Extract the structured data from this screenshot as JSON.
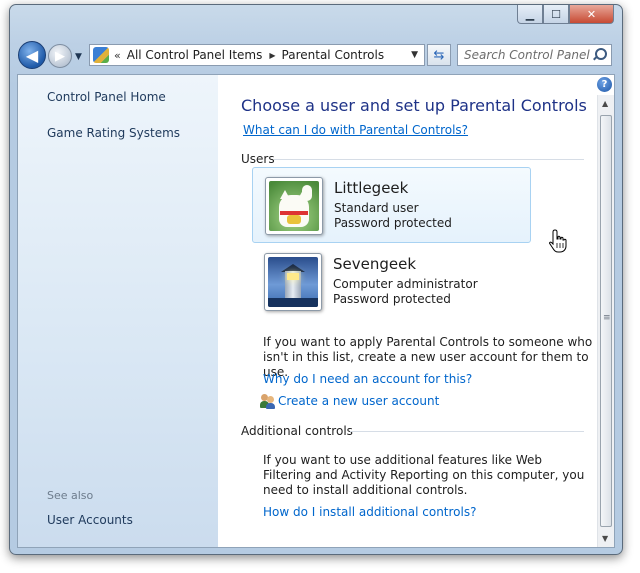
{
  "window": {
    "caption": {
      "minimize": "▁",
      "maximize": "☐",
      "close": "✕"
    }
  },
  "nav": {
    "back_icon": "arrow-left-icon",
    "forward_icon": "arrow-right-icon",
    "address": {
      "chevron": "«",
      "crumbs": [
        "All Control Panel Items",
        "Parental Controls"
      ],
      "separator": "▶"
    },
    "search": {
      "placeholder": "Search Control Panel"
    }
  },
  "sidebar": {
    "items": [
      {
        "label": "Control Panel Home"
      },
      {
        "label": "Game Rating Systems"
      }
    ],
    "see_also": {
      "heading": "See also",
      "items": [
        {
          "label": "User Accounts"
        }
      ]
    }
  },
  "main": {
    "title": "Choose a user and set up Parental Controls",
    "help_link": "What can I do with Parental Controls?",
    "users_heading": "Users",
    "users": [
      {
        "name": "Littlegeek",
        "type": "Standard user",
        "status": "Password protected",
        "selected": true,
        "picture": "lucky-cat-icon"
      },
      {
        "name": "Sevengeek",
        "type": "Computer administrator",
        "status": "Password protected",
        "selected": false,
        "picture": "lighthouse-icon"
      }
    ],
    "apply_text": "If you want to apply Parental Controls to someone who isn't in this list, create a new user account for them to use.",
    "why_link": "Why do I need an account for this?",
    "create_link": "Create a new user account",
    "additional_heading": "Additional controls",
    "additional_text": "If you want to use additional features like Web Filtering and Activity Reporting on this computer, you need to install additional controls.",
    "install_link": "How do I install additional controls?"
  },
  "colors": {
    "link": "#0066cc",
    "title": "#1e3287",
    "sidebar_link": "#1e395b",
    "selection_border": "#a8d2f2"
  }
}
